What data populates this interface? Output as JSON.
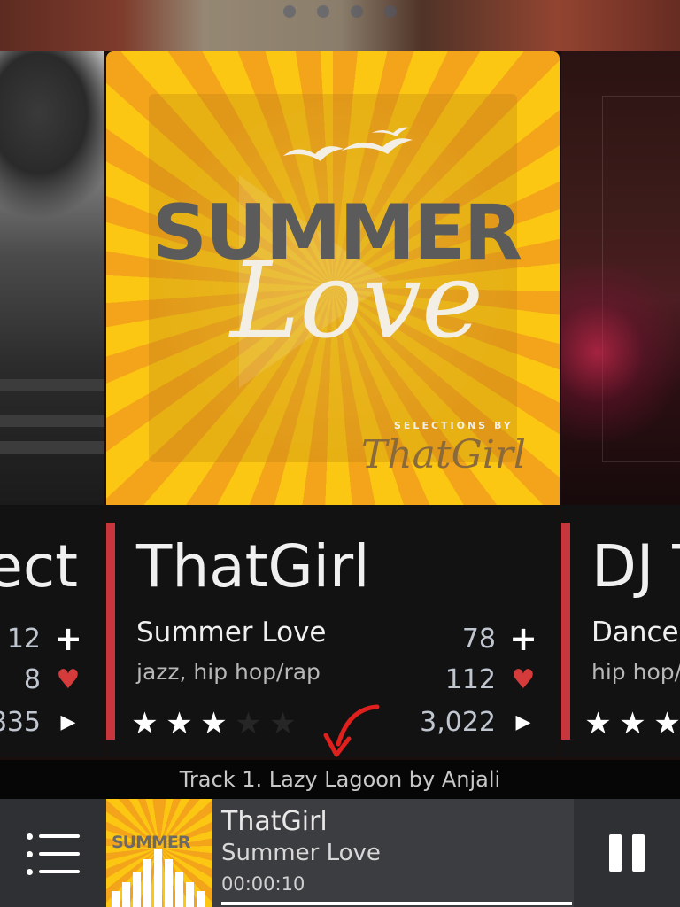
{
  "pager": {
    "count": 4,
    "active": 0
  },
  "cards": {
    "left": {
      "artist": "ect",
      "stats": {
        "likes": "12",
        "hearts": "8",
        "plays": "835"
      }
    },
    "center": {
      "artist": "ThatGirl",
      "title": "Summer Love",
      "genres": "jazz, hip hop/rap",
      "rating": 3,
      "rating_max": 5,
      "stats": {
        "likes": "78",
        "hearts": "112",
        "plays": "3,022"
      },
      "cover": {
        "headline": "SUMMER",
        "script": "Love",
        "credit_small": "SELECTIONS BY",
        "credit_brand": "ThatGirl"
      }
    },
    "right": {
      "artist": "DJ T",
      "title": "Dance",
      "genres": "hip hop/",
      "rating": 3
    }
  },
  "ticker": {
    "text": "Track 1. Lazy Lagoon by Anjali"
  },
  "player": {
    "artist": "ThatGirl",
    "title": "Summer Love",
    "elapsed": "00:00:10",
    "progress": 0,
    "thumb_headline": "SUMMER"
  },
  "colors": {
    "accent_red": "#c6363c",
    "heart_red": "#d63b3b",
    "cover_yellow": "#fbc712",
    "cover_orange": "#f3a41a",
    "card_bg": "#121212",
    "player_bg": "#3c3d40"
  },
  "icons": {
    "add": "plus-icon",
    "favorite": "heart-icon",
    "plays": "play-icon",
    "menu": "menu-icon",
    "pause": "pause-icon"
  }
}
